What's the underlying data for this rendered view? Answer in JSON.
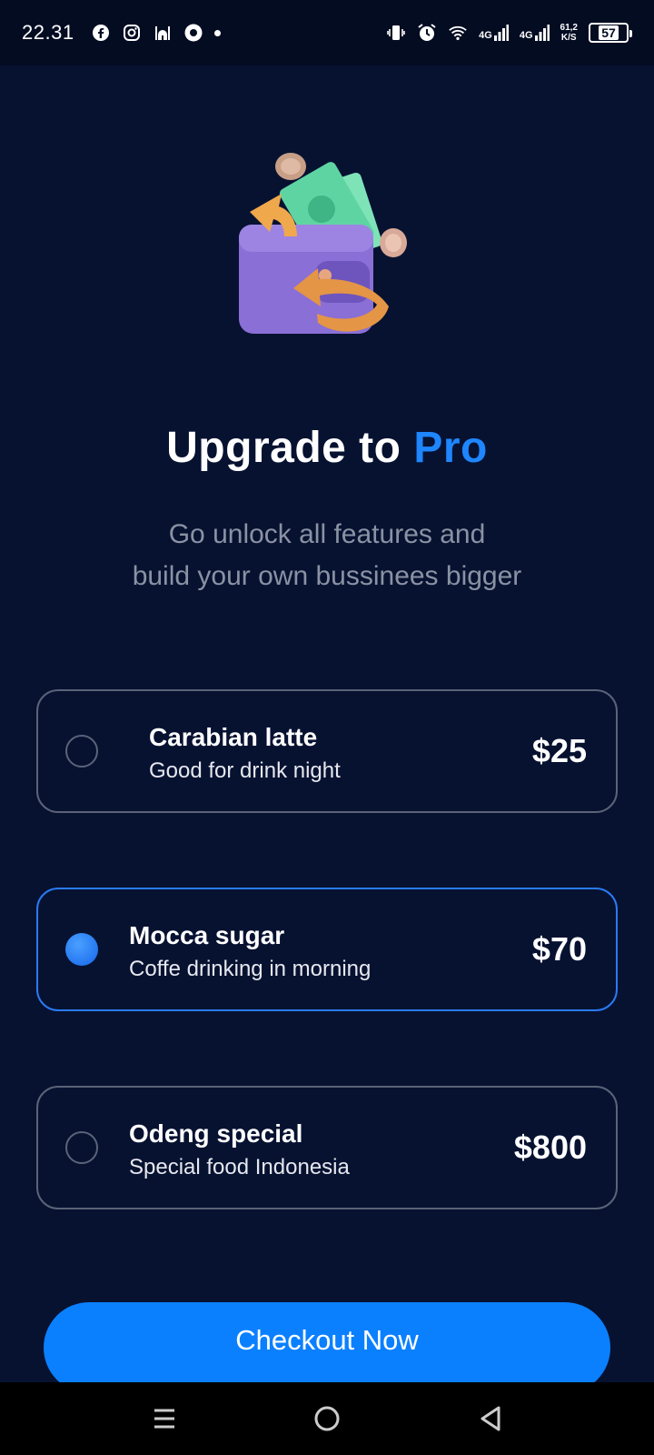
{
  "status_bar": {
    "time": "22.31",
    "net_1": "4G",
    "net_2": "4G",
    "speed_value": "61,2",
    "speed_unit": "K/S",
    "battery": "57"
  },
  "header": {
    "title_main": "Upgrade to",
    "title_accent": "Pro",
    "subtitle_line1": "Go unlock all features and",
    "subtitle_line2": "build your own bussinees bigger"
  },
  "plans": [
    {
      "name": "Carabian latte",
      "description": "Good for drink night",
      "price": "$25",
      "selected": false
    },
    {
      "name": "Mocca sugar",
      "description": "Coffe drinking in morning",
      "price": "$70",
      "selected": true
    },
    {
      "name": "Odeng special",
      "description": "Special food Indonesia",
      "price": "$800",
      "selected": false
    }
  ],
  "checkout": {
    "label": "Checkout Now"
  },
  "colors": {
    "background": "#071231",
    "accent": "#1e86ff",
    "button": "#0b80ff",
    "border": "#5a6378"
  },
  "icons": {
    "status_left": [
      "facebook-icon",
      "instagram-icon",
      "mosque-icon",
      "location-icon"
    ],
    "status_right": [
      "vibrate-icon",
      "alarm-icon",
      "wifi-icon",
      "signal-icon",
      "battery-icon"
    ],
    "nav": [
      "recents-icon",
      "home-icon",
      "back-icon"
    ]
  }
}
